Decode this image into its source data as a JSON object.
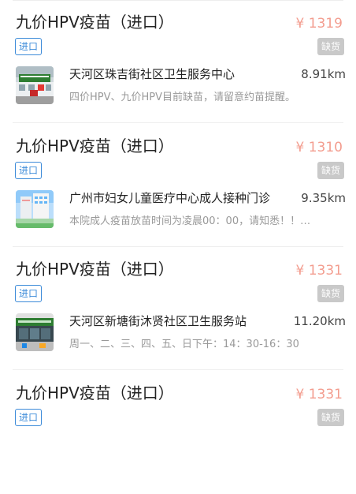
{
  "items": [
    {
      "vaccine_name": "九价HPV疫苗（进口）",
      "price": "¥ 1319",
      "tag": "进口",
      "stock_status": "缺货",
      "site_name": "天河区珠吉街社区卫生服务中心",
      "distance": "8.91km",
      "notice": "四价HPV、九价HPV目前缺苗，请留意约苗提醒。",
      "thumb_icon": "clinic-photo"
    },
    {
      "vaccine_name": "九价HPV疫苗（进口）",
      "price": "¥ 1310",
      "tag": "进口",
      "stock_status": "缺货",
      "site_name": "广州市妇女儿童医疗中心成人接种门诊",
      "distance": "9.35km",
      "notice": "本院成人疫苗放苗时间为凌晨00：00，请知悉！！…",
      "thumb_icon": "hospital-photo"
    },
    {
      "vaccine_name": "九价HPV疫苗（进口）",
      "price": "¥ 1331",
      "tag": "进口",
      "stock_status": "缺货",
      "site_name": "天河区新塘街沐贤社区卫生服务站",
      "distance": "11.20km",
      "notice": "周一、二、三、四、五、日下午：14：30-16：30",
      "thumb_icon": "clinic-photo"
    },
    {
      "vaccine_name": "九价HPV疫苗（进口）",
      "price": "¥ 1331",
      "tag": "进口",
      "stock_status": "缺货"
    }
  ],
  "colors": {
    "price": "#f39d8f",
    "tag_blue": "#3c8bd9",
    "badge_gray": "#c9c9c9",
    "text_primary": "#222222",
    "text_secondary": "#999999"
  }
}
